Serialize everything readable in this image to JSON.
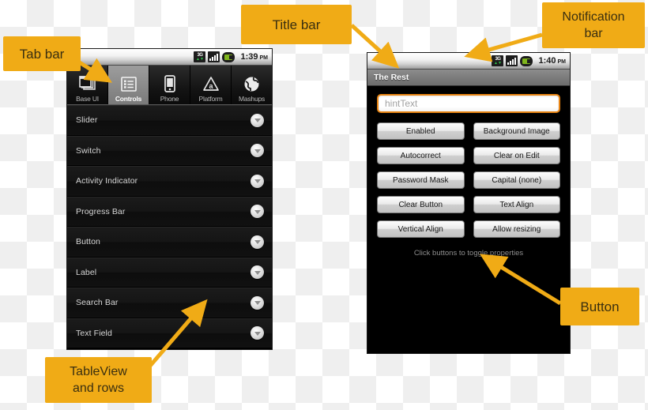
{
  "meta": {
    "accent_color": "#f0ab16",
    "phone_bg": "#000000",
    "highlight_border": "#e88413"
  },
  "annotations": [
    {
      "id": "tab-bar",
      "label": "Tab bar"
    },
    {
      "id": "title-bar",
      "label": "Title bar"
    },
    {
      "id": "notification-bar",
      "label": "Notification\nbar",
      "line1": "Notification",
      "line2": "bar"
    },
    {
      "id": "tableview",
      "label": "TableView and rows",
      "line1": "TableView",
      "line2": "and rows"
    },
    {
      "id": "button",
      "label": "Button"
    }
  ],
  "left_phone": {
    "statusbar": {
      "network_label": "3G",
      "time": "1:39",
      "ampm": "PM",
      "icons": [
        "3g-icon",
        "signal-icon",
        "battery-icon"
      ]
    },
    "tabs": [
      {
        "label": "Base UI",
        "icon": "windows-stack-icon",
        "selected": false
      },
      {
        "label": "Controls",
        "icon": "list-icon",
        "selected": true
      },
      {
        "label": "Phone",
        "icon": "phone-icon",
        "selected": false
      },
      {
        "label": "Platform",
        "icon": "platform-a-icon",
        "selected": false
      },
      {
        "label": "Mashups",
        "icon": "globe-icon",
        "selected": false
      }
    ],
    "rows": [
      {
        "label": "Slider",
        "accessory": "chevron-down-icon"
      },
      {
        "label": "Switch",
        "accessory": "chevron-down-icon"
      },
      {
        "label": "Activity Indicator",
        "accessory": "chevron-down-icon"
      },
      {
        "label": "Progress Bar",
        "accessory": "chevron-down-icon"
      },
      {
        "label": "Button",
        "accessory": "chevron-down-icon"
      },
      {
        "label": "Label",
        "accessory": "chevron-down-icon"
      },
      {
        "label": "Search Bar",
        "accessory": "chevron-down-icon"
      },
      {
        "label": "Text Field",
        "accessory": "chevron-down-icon"
      }
    ]
  },
  "right_phone": {
    "statusbar": {
      "network_label": "3G",
      "time": "1:40",
      "ampm": "PM",
      "icons": [
        "3g-icon",
        "signal-icon",
        "battery-icon"
      ]
    },
    "titlebar": {
      "title": "The Rest"
    },
    "textfield": {
      "value": "",
      "placeholder": "hintText"
    },
    "buttons": [
      {
        "label": "Enabled"
      },
      {
        "label": "Background Image"
      },
      {
        "label": "Autocorrect"
      },
      {
        "label": "Clear on Edit"
      },
      {
        "label": "Password Mask"
      },
      {
        "label": "Capital (none)"
      },
      {
        "label": "Clear Button"
      },
      {
        "label": "Text Align"
      },
      {
        "label": "Vertical Align"
      },
      {
        "label": "Allow resizing"
      }
    ],
    "note": "Click buttons to toggle properties"
  }
}
